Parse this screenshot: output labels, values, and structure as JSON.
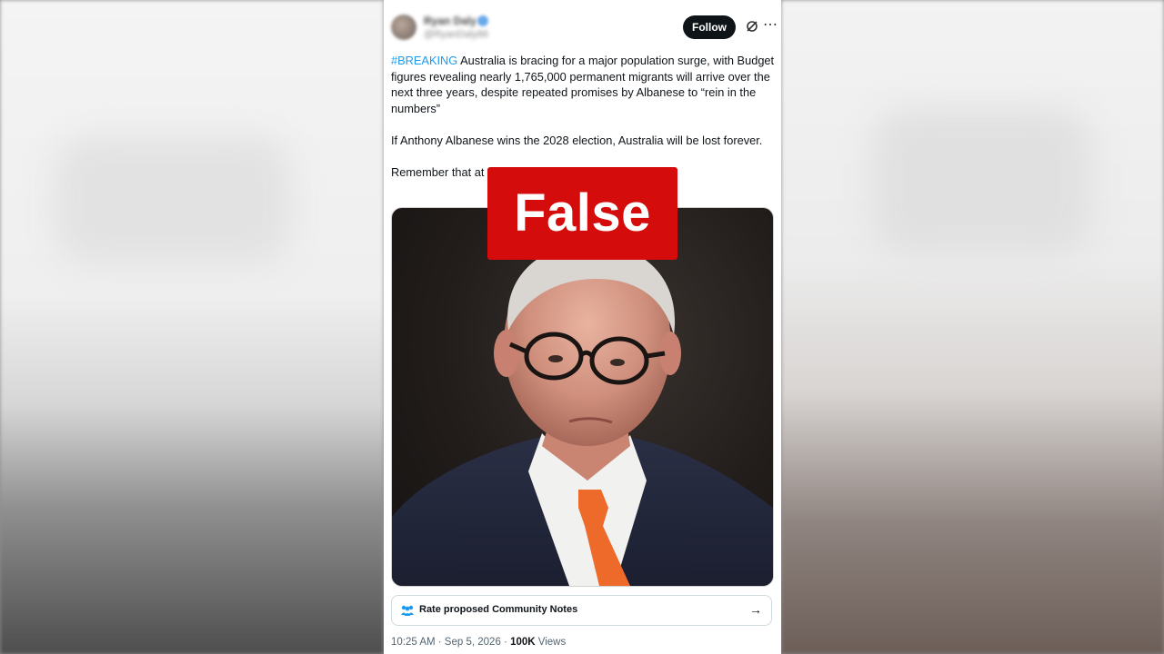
{
  "post": {
    "author_name": "Ryan Daly",
    "author_handle": "@RyanDaly86",
    "follow_label": "Follow",
    "more_icon": "more-icon",
    "hashtag": "#BREAKING",
    "paragraph1_rest": " Australia is bracing for a major population surge, with Budget figures revealing nearly 1,765,000 permanent migrants will arrive over the next three years, despite repeated promises by Albanese to “rein in the numbers”",
    "paragraph2": "If Anthony Albanese wins the 2028 election, Australia will be lost forever.",
    "paragraph3": "Remember that at",
    "timestamp": "10:25 AM · Sep 5, 2026 · ",
    "views_count": "100K",
    "views_label": " Views"
  },
  "overlay": {
    "verdict": "False",
    "verdict_color": "#d40c0c"
  },
  "community_notes": {
    "label": "Rate proposed Community Notes",
    "icon": "community-notes-icon",
    "arrow": "→"
  },
  "colors": {
    "link": "#1d9bf0",
    "follow_bg": "#0f1419"
  }
}
